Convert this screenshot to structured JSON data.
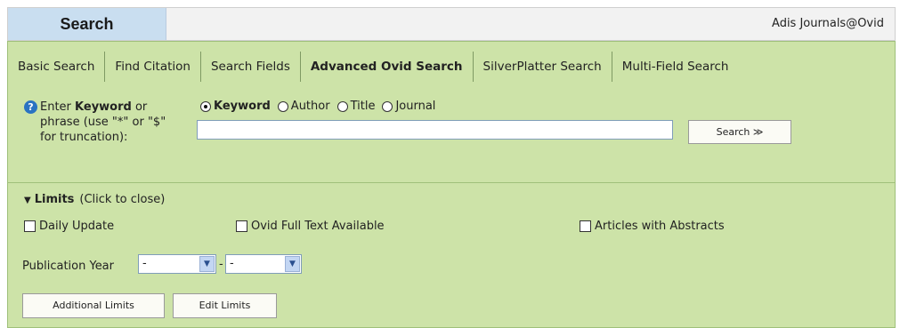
{
  "header": {
    "tab_label": "Search",
    "database": "Adis Journals@Ovid"
  },
  "tabs": [
    {
      "label": "Basic Search",
      "active": false
    },
    {
      "label": "Find Citation",
      "active": false
    },
    {
      "label": "Search Fields",
      "active": false
    },
    {
      "label": "Advanced Ovid Search",
      "active": true
    },
    {
      "label": "SilverPlatter Search",
      "active": false
    },
    {
      "label": "Multi-Field Search",
      "active": false
    }
  ],
  "search": {
    "prompt_pre": "Enter ",
    "prompt_bold": "Keyword",
    "prompt_post": " or phrase (use \"*\" or \"$\" for truncation):",
    "input_value": "",
    "radios": [
      {
        "label": "Keyword",
        "checked": true
      },
      {
        "label": "Author",
        "checked": false
      },
      {
        "label": "Title",
        "checked": false
      },
      {
        "label": "Journal",
        "checked": false
      }
    ],
    "button_label": "Search ≫"
  },
  "limits": {
    "title": "Limits",
    "hint": "(Click to close)",
    "checkboxes": [
      {
        "label": "Daily Update",
        "checked": false
      },
      {
        "label": "Ovid Full Text Available",
        "checked": false
      },
      {
        "label": "Articles with Abstracts",
        "checked": false
      }
    ],
    "pub_year_label": "Publication Year",
    "pub_year_from": "-",
    "pub_year_separator": "-",
    "pub_year_to": "-",
    "additional_button": "Additional Limits",
    "edit_button": "Edit Limits"
  }
}
